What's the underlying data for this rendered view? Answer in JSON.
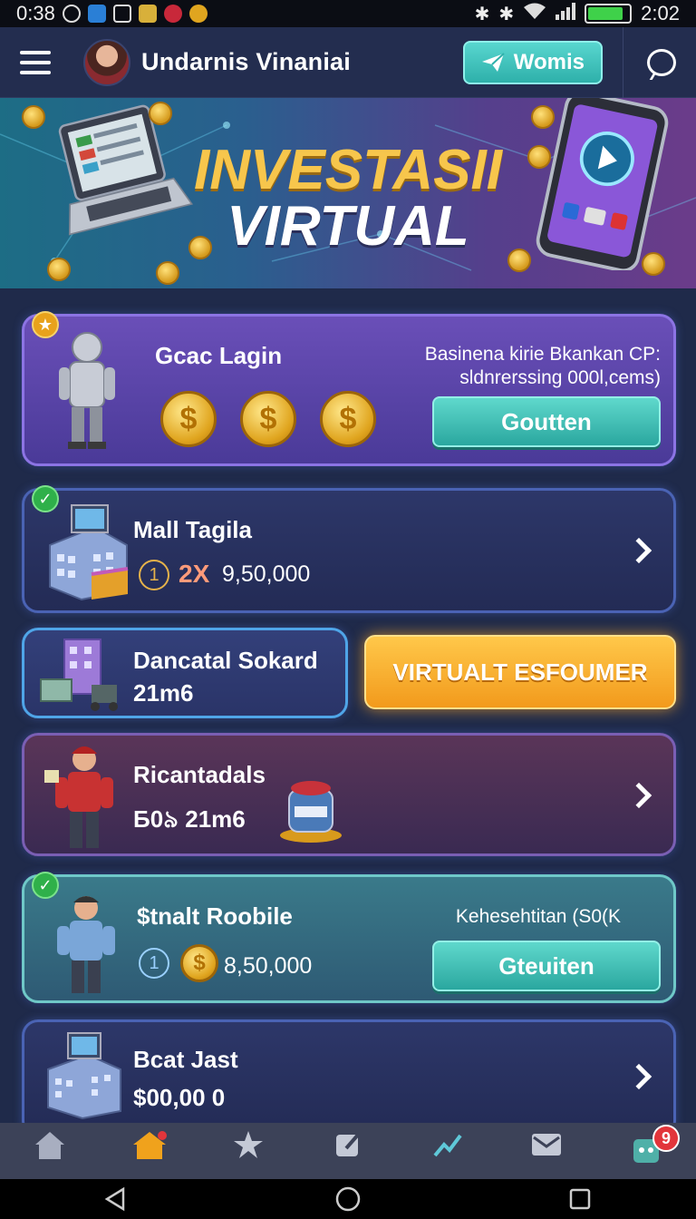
{
  "status_bar": {
    "time_left": "0:38",
    "time_right": "2:02",
    "battery_level": 0.85
  },
  "header": {
    "title": "Undarnis Vinaniai",
    "action_button": "Womis"
  },
  "banner": {
    "line1": "INVESTASII",
    "line2": "VIRTUAL"
  },
  "cards": [
    {
      "title": "Gcac Lagin",
      "desc_line1": "Basinena kirie Bkankan CP:",
      "desc_line2": "sldnrerssing 000l,cems)",
      "button": "Goutten"
    },
    {
      "title": "Mall Tagila",
      "index": "1",
      "multiplier": "2X",
      "amount": "9,50,000"
    },
    {
      "title": "Dancatal Sokard",
      "sub": "21m6"
    },
    {
      "cta": "VIRTUALT ESFOUMER"
    },
    {
      "title": "Ricantadals",
      "sub": "Б0৯ 21m6"
    },
    {
      "title": "$tnalt Roobile",
      "desc": "Kehesehtitan (S0(K",
      "index": "1",
      "amount": "8,50,000",
      "button": "Gteuiten"
    },
    {
      "title": "Bcat Jast",
      "amount": "$00,00 0"
    }
  ],
  "bottom_nav": {
    "badge_count": "9"
  },
  "colors": {
    "accent_teal": "#2eb0aa",
    "gold": "#f7c64c",
    "cta_orange": "#f5a623",
    "card_border": "#4a63b4"
  }
}
